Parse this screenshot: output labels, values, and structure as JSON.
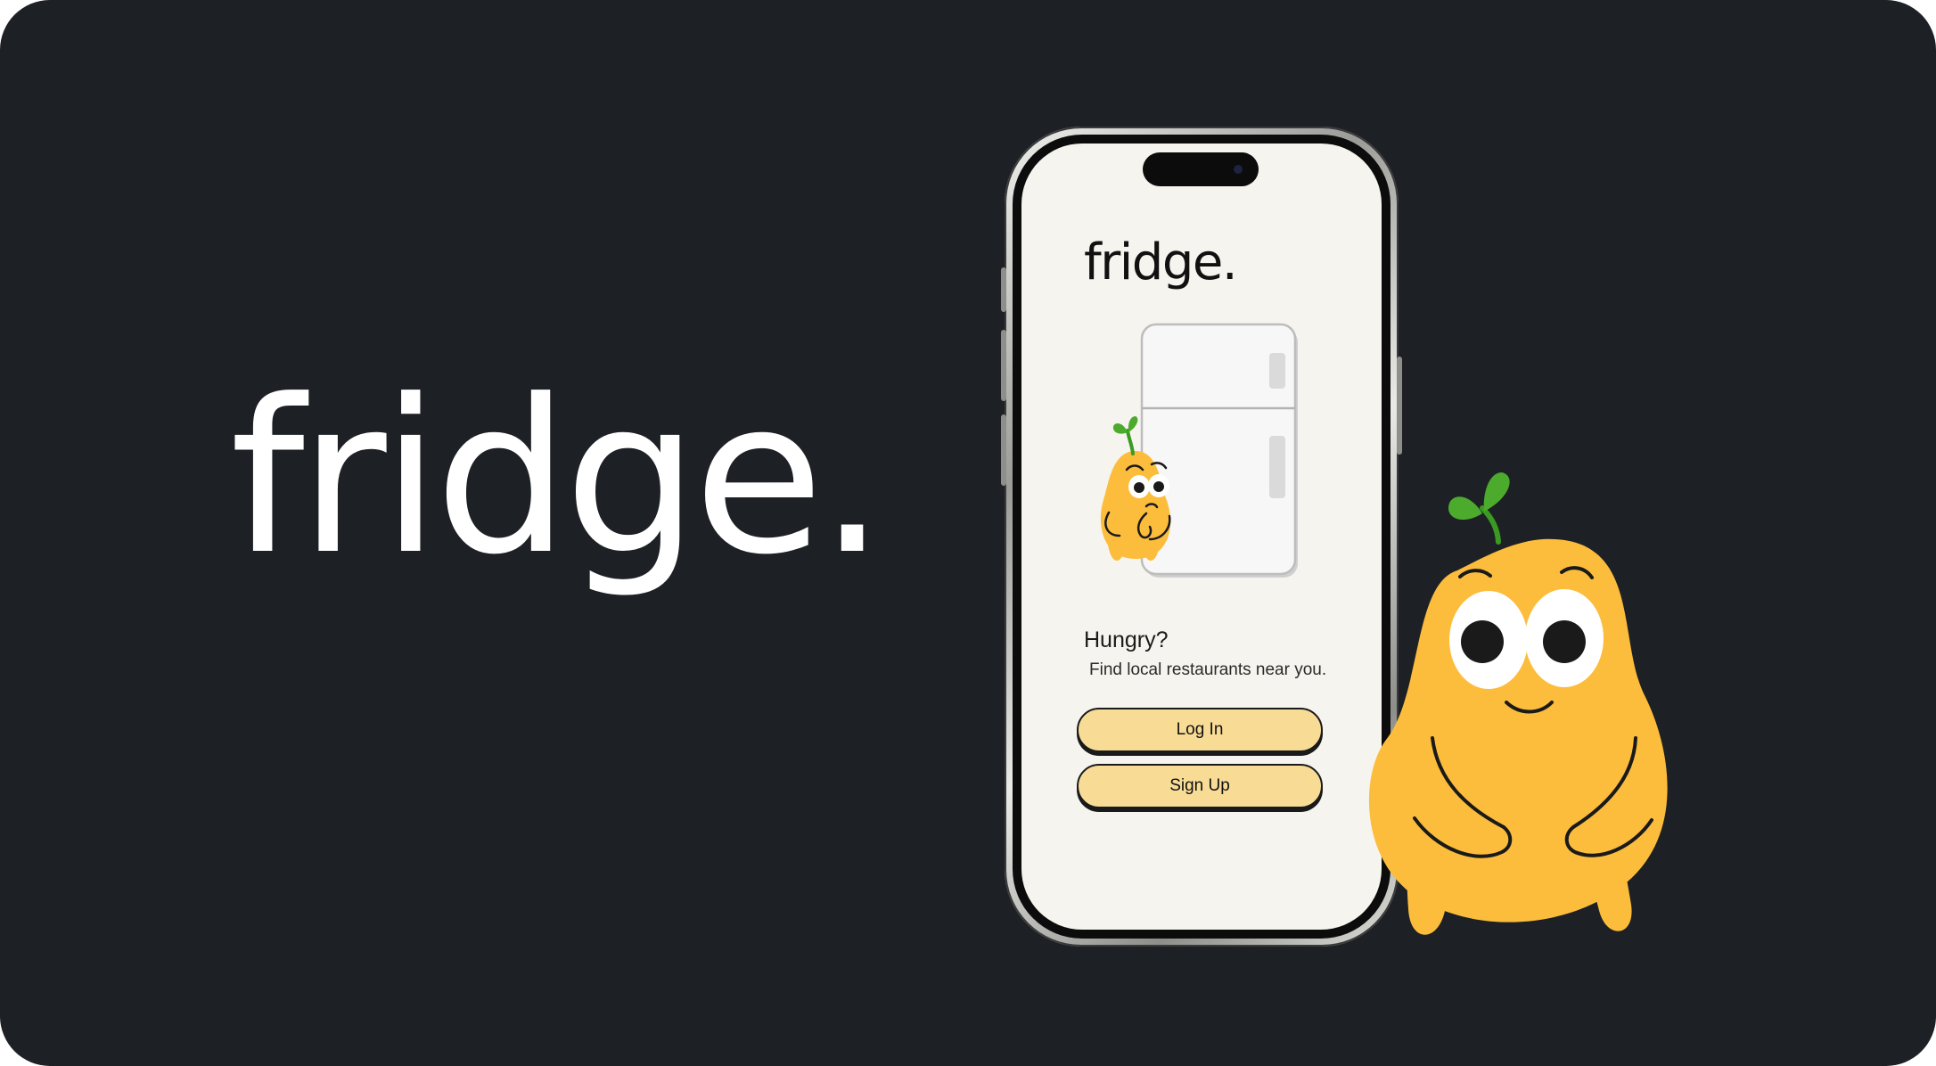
{
  "brand": {
    "logo_text": "fridge."
  },
  "app_screen": {
    "logo_text": "fridge.",
    "headline": "Hungry?",
    "tagline": "Find local restaurants near you.",
    "buttons": {
      "login_label": "Log In",
      "signup_label": "Sign Up"
    }
  },
  "colors": {
    "background": "#1d2025",
    "screen_background": "#f6f4ee",
    "button_fill": "#f8dc96",
    "mascot_yellow": "#fcbd3c",
    "leaf_green": "#4caa2c"
  },
  "icons": {
    "mascot": "pear-mascot",
    "appliance": "refrigerator"
  }
}
